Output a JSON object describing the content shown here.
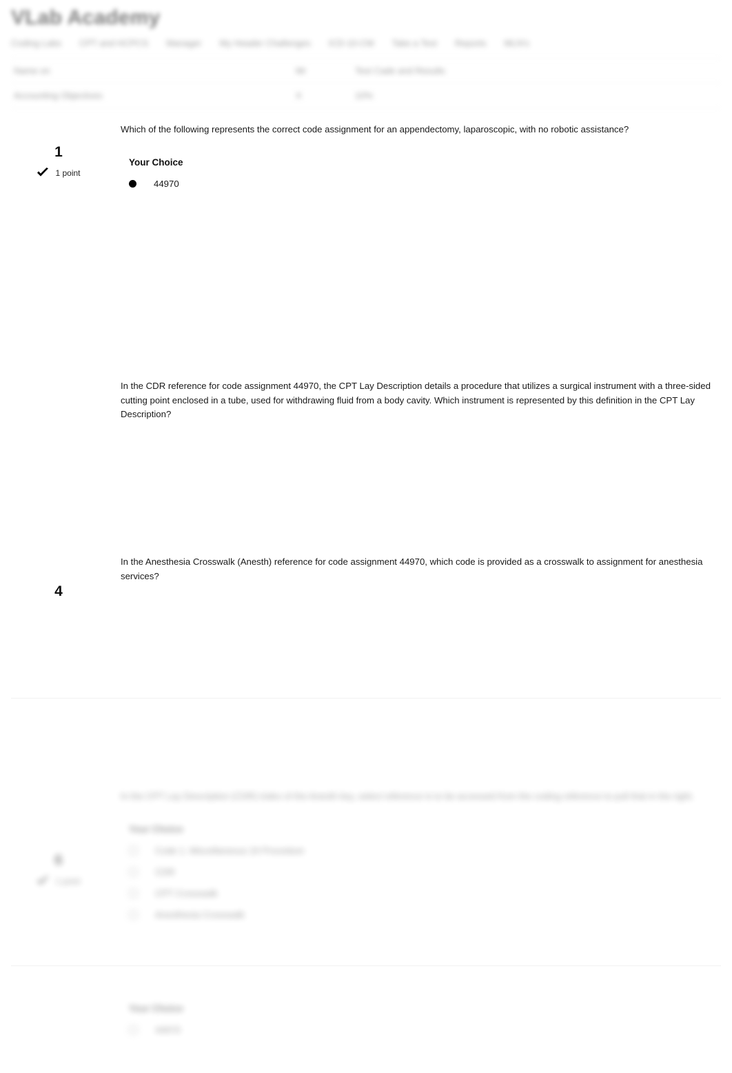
{
  "header": {
    "brand_title": "VLab Academy",
    "nav_items": [
      "Coding Labs",
      "CPT and HCPCS",
      "Manager",
      "My Header Challenges",
      "ICD-10-CM",
      "Take a Test",
      "Reports",
      "MLN's"
    ]
  },
  "meta_table": {
    "rows": [
      {
        "label": "Name on",
        "mid": "Mr",
        "value": "Test Cade and Results"
      },
      {
        "label": "Accounting Objectives",
        "mid": "X",
        "value": "10%"
      }
    ]
  },
  "questions": [
    {
      "number": "1",
      "points": "1 point",
      "status_icon": "check-icon",
      "text": "Which of the following represents the correct code assignment for an appendectomy, laparoscopic, with no robotic assistance?",
      "choice_heading": "Your Choice",
      "choices": [
        {
          "selected": true,
          "text": "44970"
        }
      ]
    },
    {
      "number": "",
      "points": "",
      "status_icon": "",
      "text": "In the CDR reference for code assignment 44970, the CPT Lay Description details a procedure that utilizes a surgical instrument with a three-sided cutting point enclosed in a tube, used for withdrawing fluid from a body cavity. Which instrument is represented by this definition in the CPT Lay Description?",
      "choice_heading": "",
      "choices": []
    },
    {
      "number": "4",
      "points": "",
      "status_icon": "",
      "text": "In the Anesthesia Crosswalk (Anesth) reference for code assignment 44970, which code is provided as a crosswalk to assignment for anesthesia services?",
      "choice_heading": "",
      "choices": []
    },
    {
      "number": "6",
      "points": "1 point",
      "status_icon": "check-icon",
      "text": "In the CPT Lay Description (CDR) index of the Anesth key, select reference is to be accessed from the coding reference to pull that in the right.",
      "choice_heading": "Your Choice",
      "choices": [
        {
          "selected": false,
          "text": "Code 1. Miscellaneous 24 Procedure"
        },
        {
          "selected": false,
          "text": "CDR"
        },
        {
          "selected": false,
          "text": "CPT Crosswalk"
        },
        {
          "selected": false,
          "text": "Anesthesia Crosswalk"
        }
      ]
    },
    {
      "number": "",
      "points": "",
      "status_icon": "",
      "text": "",
      "choice_heading": "Your Choice",
      "choices": [
        {
          "selected": false,
          "text": "44970"
        }
      ]
    }
  ]
}
